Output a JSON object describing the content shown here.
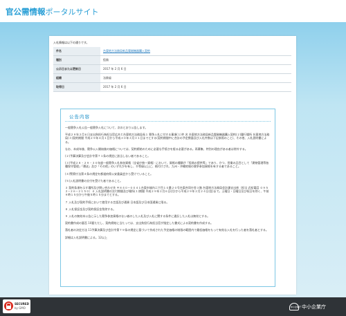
{
  "header": {
    "title": "官公需情報",
    "subtitle": "ポータルサイト"
  },
  "panel": {
    "intro": "入札情報は以下の通りです。",
    "rows": [
      {
        "label": "件名",
        "value": "台東地方法務局新品電磁機器購入契約"
      },
      {
        "label": "種別",
        "value": "役務"
      },
      {
        "label": "公示日または更新日",
        "value": "2017 年 2 月 6 日"
      },
      {
        "label": "組織",
        "value": "法務省"
      },
      {
        "label": "取得日",
        "value": "2017 年 2 月 6 日"
      }
    ]
  },
  "notice": {
    "title": "公告内容",
    "paragraphs": [
      "一般競争入札公告一般競争入札について、次のとおり公告します。",
      "平成２９年２月６日支出負担行為担当官広木Ｃ台東地方法務局長１ 競争入札に付する事項(１)件 名 台東地方法務局新品電磁機器購入契約(２)履行場所 台東地方法務局(３)契約期間 平成２９年４月１日から平成３０年３月３１日までとする(契約期間中に合計の予定数量及び入札件数は下記参照のこと)、その他、入札説明書による。",
      "なお、本成年後、競争公入開始後の価格については、契約締結のために必要な手続きを経る必要がある。再募集、特別の理由がある者は除外する。",
      "(２)予算決算及び会計令第７１条の規定に該当しない者であること。",
      "(３)平成２８・２９・３０年度一般競争入札参加資格（全省庁統一資格）において、資格の種類が「役務の提供等」であり、かつ、営業の品目として「建物管理等各種保守管理」「運送」及び「その他」のいずれかを有し、Ｄ等級以上に、格付けされ、九州・沖縄地域の競争参加資格を有する者であること。",
      "(４)警察庁法第４条の規定を都道府県公安委員会から受けていること。",
      "(５)入札説明書の交付を受けた者であること。",
      "３ 契約条項を示す場所及び問い合わせ先 〒８４０−００４１台東市城内二丁目１０番２０号台東合同庁舎３階 台東地方法務局会計課支出係（担当 近松電話 ０９５２−２６−２１５０）４ 入札説明書の交付期間及び場所(１)期間 平成２９年２月６日(月)から平成２９年２月２４日(金)まで。土曜日・日曜日及び祝日を除く、午前９時１５分から午後５時１５分までとする。",
      "７ 入札及び契約手続において使用する言語及び通貨 日本語及び日本国通貨に限る。",
      "８ 入札保証金及び契約保証金免除する。",
      "９ 入札の無効本公告に示した競争参加資格のない者のした入札及び入札に関する条件に違反した入札は無効とする。",
      "契約書作成の要否 10要ただし、契約締結に当たっては、支出負担行為担当官が指定した書式による契約書を作成する。",
      "落札者の決定方法 11予算決算及び会計令第７９条の規定に基づいて作成された予定価格の制限の範囲内で最低価格をもって有効な入札を行った者を落札者とする。",
      "詳細は入札説明書による。12以上"
    ]
  },
  "footer": {
    "badge_title": "SECURED",
    "badge_sub": "by GMO",
    "emblem": "中小企業庁",
    "agency_name": "中小企業庁"
  }
}
